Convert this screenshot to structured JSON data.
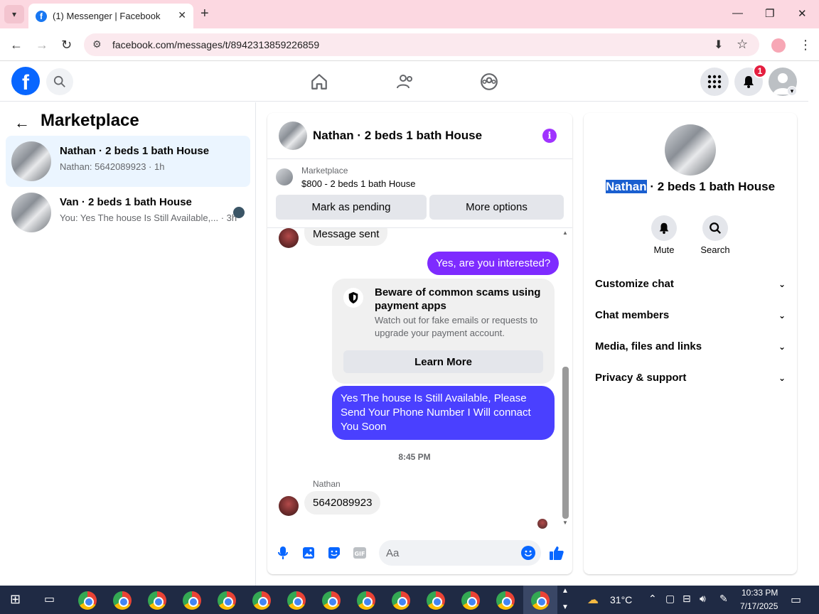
{
  "browser": {
    "tab_title": "(1) Messenger | Facebook",
    "url": "facebook.com/messages/t/8942313859226859"
  },
  "header": {
    "notification_count": "1"
  },
  "left_panel": {
    "title": "Marketplace",
    "conversations": [
      {
        "title": "Nathan · 2 beds 1 bath House",
        "subtitle": "Nathan: 5642089923 · 1h",
        "active": true
      },
      {
        "title": "Van · 2 beds 1 bath House",
        "subtitle": "You: Yes The house Is Still Available,... · 3h",
        "active": false
      }
    ]
  },
  "chat": {
    "title": "Nathan · 2 beds 1 bath House",
    "marketplace_label": "Marketplace",
    "listing": "$800 - 2 beds 1 bath House",
    "mark_pending": "Mark as pending",
    "more_options": "More options",
    "messages": {
      "partial_in": "Message sent",
      "out_1": "Yes, are you interested?",
      "scam_title": "Beware of common scams using payment apps",
      "scam_desc": "Watch out for fake emails or requests to upgrade your payment account.",
      "learn_more": "Learn More",
      "out_2": "Yes The house Is Still Available, Please Send Your Phone Number I Will connact You Soon",
      "time": "8:45 PM",
      "sender": "Nathan",
      "in_1": "5642089923"
    },
    "composer_placeholder": "Aa"
  },
  "right_panel": {
    "title_highlight": "Nathan",
    "title_rest": " · 2 beds 1 bath House",
    "mute": "Mute",
    "search": "Search",
    "sections": [
      "Customize chat",
      "Chat members",
      "Media, files and links",
      "Privacy & support"
    ]
  },
  "taskbar": {
    "temperature": "31°C",
    "time": "10:33 PM",
    "date": "7/17/2025"
  }
}
